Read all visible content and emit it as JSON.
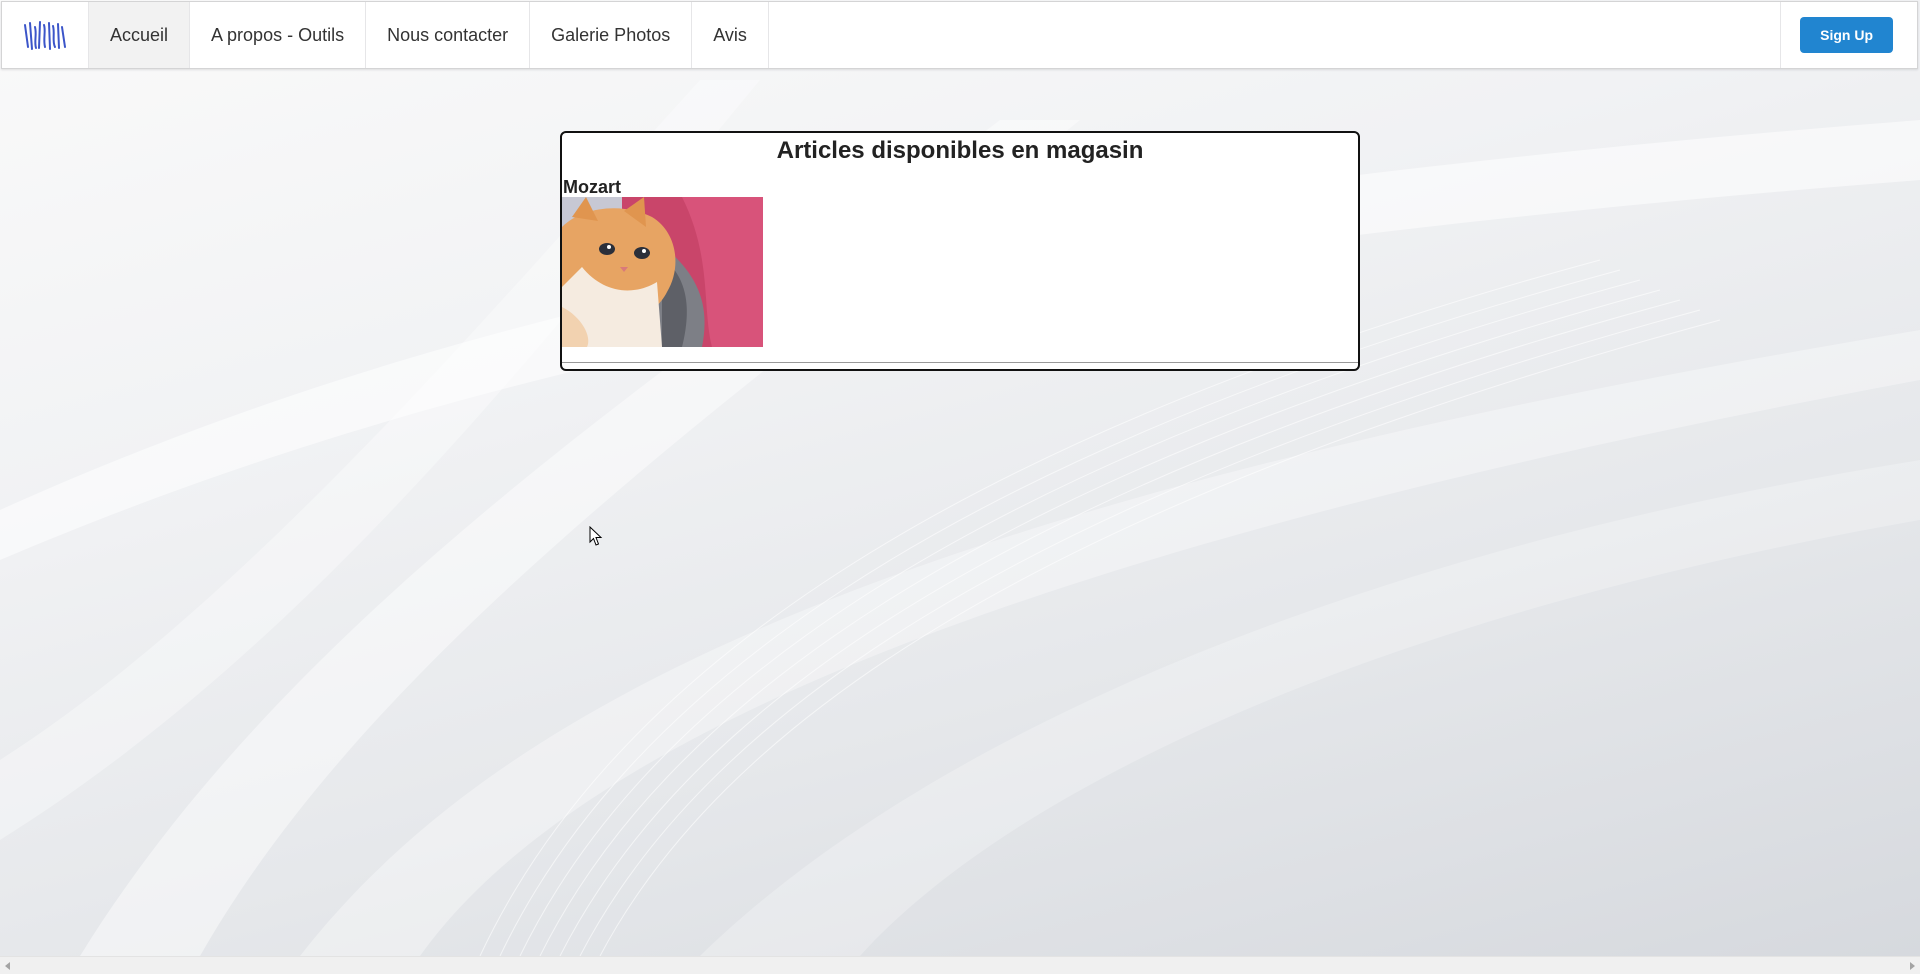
{
  "nav": {
    "logo_icon": "site-logo-icon",
    "items": [
      {
        "label": "Accueil",
        "active": true
      },
      {
        "label": "A propos - Outils",
        "active": false
      },
      {
        "label": "Nous contacter",
        "active": false
      },
      {
        "label": "Galerie Photos",
        "active": false
      },
      {
        "label": "Avis",
        "active": false
      }
    ],
    "signup_label": "Sign Up",
    "signup_color": "#2185d0"
  },
  "panel": {
    "title": "Articles disponibles en magasin",
    "items": [
      {
        "name": "Mozart",
        "photo_icon": "kitten-photo"
      }
    ]
  },
  "colors": {
    "menu_active_bg": "#f2f2f2",
    "panel_border": "#111111"
  }
}
